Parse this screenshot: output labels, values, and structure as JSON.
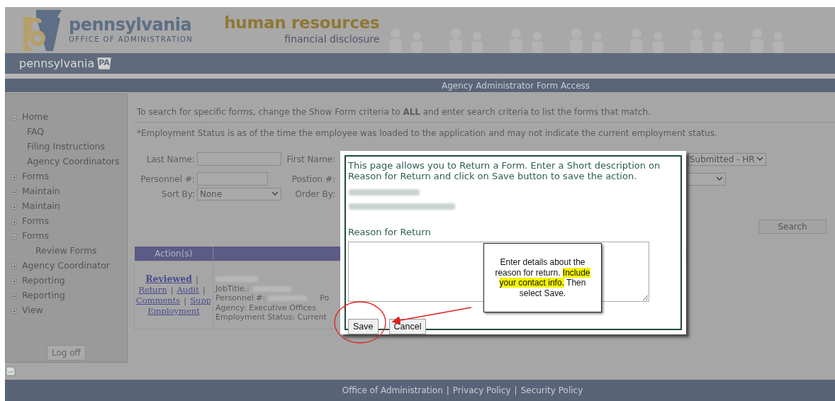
{
  "header": {
    "agency_name": "pennsylvania",
    "agency_subtitle": "OFFICE OF ADMINISTRATION",
    "app_title": "human resources",
    "app_subtitle": "financial disclosure",
    "state_name": "pennsylvania",
    "state_badge": "PA"
  },
  "page_title": "Agency Administrator Form Access",
  "sidebar": {
    "items": [
      {
        "label": "Home",
        "expanded": true,
        "children": [
          {
            "label": "FAQ"
          },
          {
            "label": "Filing Instructions"
          },
          {
            "label": "Agency Coordinators"
          }
        ]
      },
      {
        "label": "Forms",
        "expanded": false
      },
      {
        "label": "Maintain",
        "expanded": false
      },
      {
        "label": "Maintain",
        "expanded": false
      },
      {
        "label": "Forms",
        "expanded": false
      },
      {
        "label": "Forms",
        "expanded": true,
        "children": [
          {
            "label": "Review Forms"
          }
        ]
      },
      {
        "label": "Agency Coordinator",
        "expanded": false
      },
      {
        "label": "Reporting",
        "expanded": false
      },
      {
        "label": "Reporting",
        "expanded": false
      },
      {
        "label": "View",
        "expanded": false
      }
    ],
    "logoff": "Log off"
  },
  "instructions": [
    "To search for specific forms, change the Show Form criteria to **ALL** and enter search criteria to list the forms that match.",
    "*Employment Status is as of the time the employee was loaded to the application and may not indicate the current employment status."
  ],
  "search_form": {
    "last_name": {
      "label": "Last Name:"
    },
    "first_name": {
      "label": "First Name:"
    },
    "personnel": {
      "label": "Personnel #:"
    },
    "position": {
      "label": "Postion #:"
    },
    "sort_by": {
      "label": "Sort By:",
      "value": "None"
    },
    "order_by": {
      "label": "Order By:"
    },
    "status": {
      "value": "Submitted - HR"
    },
    "search_button": "Search"
  },
  "results": {
    "columns": [
      "Action(s)"
    ],
    "separator": "|",
    "rows": [
      {
        "action_lines": [
          [
            {
              "label": "Reviewed",
              "bold": true
            }
          ],
          [
            {
              "label": "Return",
              "bold": false
            },
            {
              "label": "Audit",
              "bold": false
            }
          ],
          [
            {
              "label": "Comments",
              "bold": false
            },
            {
              "label": "Supp",
              "bold": false
            }
          ],
          [
            {
              "label": "Employment",
              "bold": false
            }
          ]
        ],
        "details": [
          {
            "kind": "blurred"
          },
          {
            "kind": "labeled",
            "label": "JobTitle.:"
          },
          {
            "kind": "labeled",
            "label": "Personnel #:",
            "after": "Po"
          },
          {
            "kind": "text",
            "text": "Agency: Executive Offices"
          },
          {
            "kind": "text",
            "text": "Employment Status: Current"
          }
        ]
      }
    ]
  },
  "modal": {
    "message": "This page allows you to Return a Form. Enter a Short description on Reason for Return and click on Save button to save the action.",
    "reason_label": "Reason for Return",
    "buttons": [
      "Save",
      "Cancel"
    ]
  },
  "callout": {
    "before": "Enter details about the reason for return.",
    "highlight": "Include your contact info.",
    "after": "Then select Save."
  },
  "footer": {
    "separator": "|",
    "links": [
      "Office of Administration",
      "Privacy Policy",
      "Security Policy"
    ]
  }
}
